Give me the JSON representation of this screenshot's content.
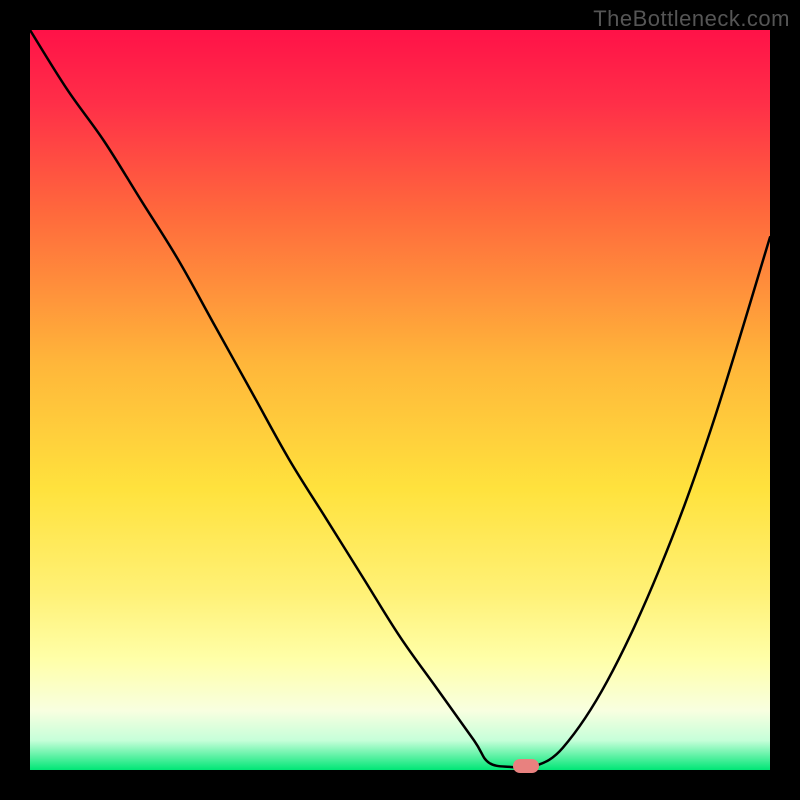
{
  "watermark": "TheBottleneck.com",
  "colors": {
    "gradient_top": "#ff1744",
    "gradient_mid1": "#ff6a3c",
    "gradient_mid2": "#ffd93d",
    "gradient_mid3": "#fff176",
    "gradient_mid4": "#ffffa8",
    "gradient_low": "#f8ffe0",
    "gradient_bottom": "#00e676",
    "curve": "#000000",
    "marker": "#e8817f",
    "background": "#000000"
  },
  "chart_data": {
    "type": "line",
    "title": "",
    "xlabel": "",
    "ylabel": "",
    "xlim": [
      0,
      100
    ],
    "ylim": [
      0,
      100
    ],
    "marker_x": 67,
    "marker_y": 0,
    "series": [
      {
        "name": "bottleneck-curve",
        "x": [
          0,
          5,
          10,
          15,
          20,
          25,
          30,
          35,
          40,
          45,
          50,
          55,
          60,
          62,
          65,
          67,
          68,
          72,
          78,
          85,
          92,
          100
        ],
        "values": [
          100,
          92,
          85,
          77,
          69,
          60,
          51,
          42,
          34,
          26,
          18,
          11,
          4,
          1,
          0.4,
          0.3,
          0.4,
          3,
          12,
          27,
          46,
          72
        ]
      }
    ],
    "grid": false,
    "legend": false
  }
}
